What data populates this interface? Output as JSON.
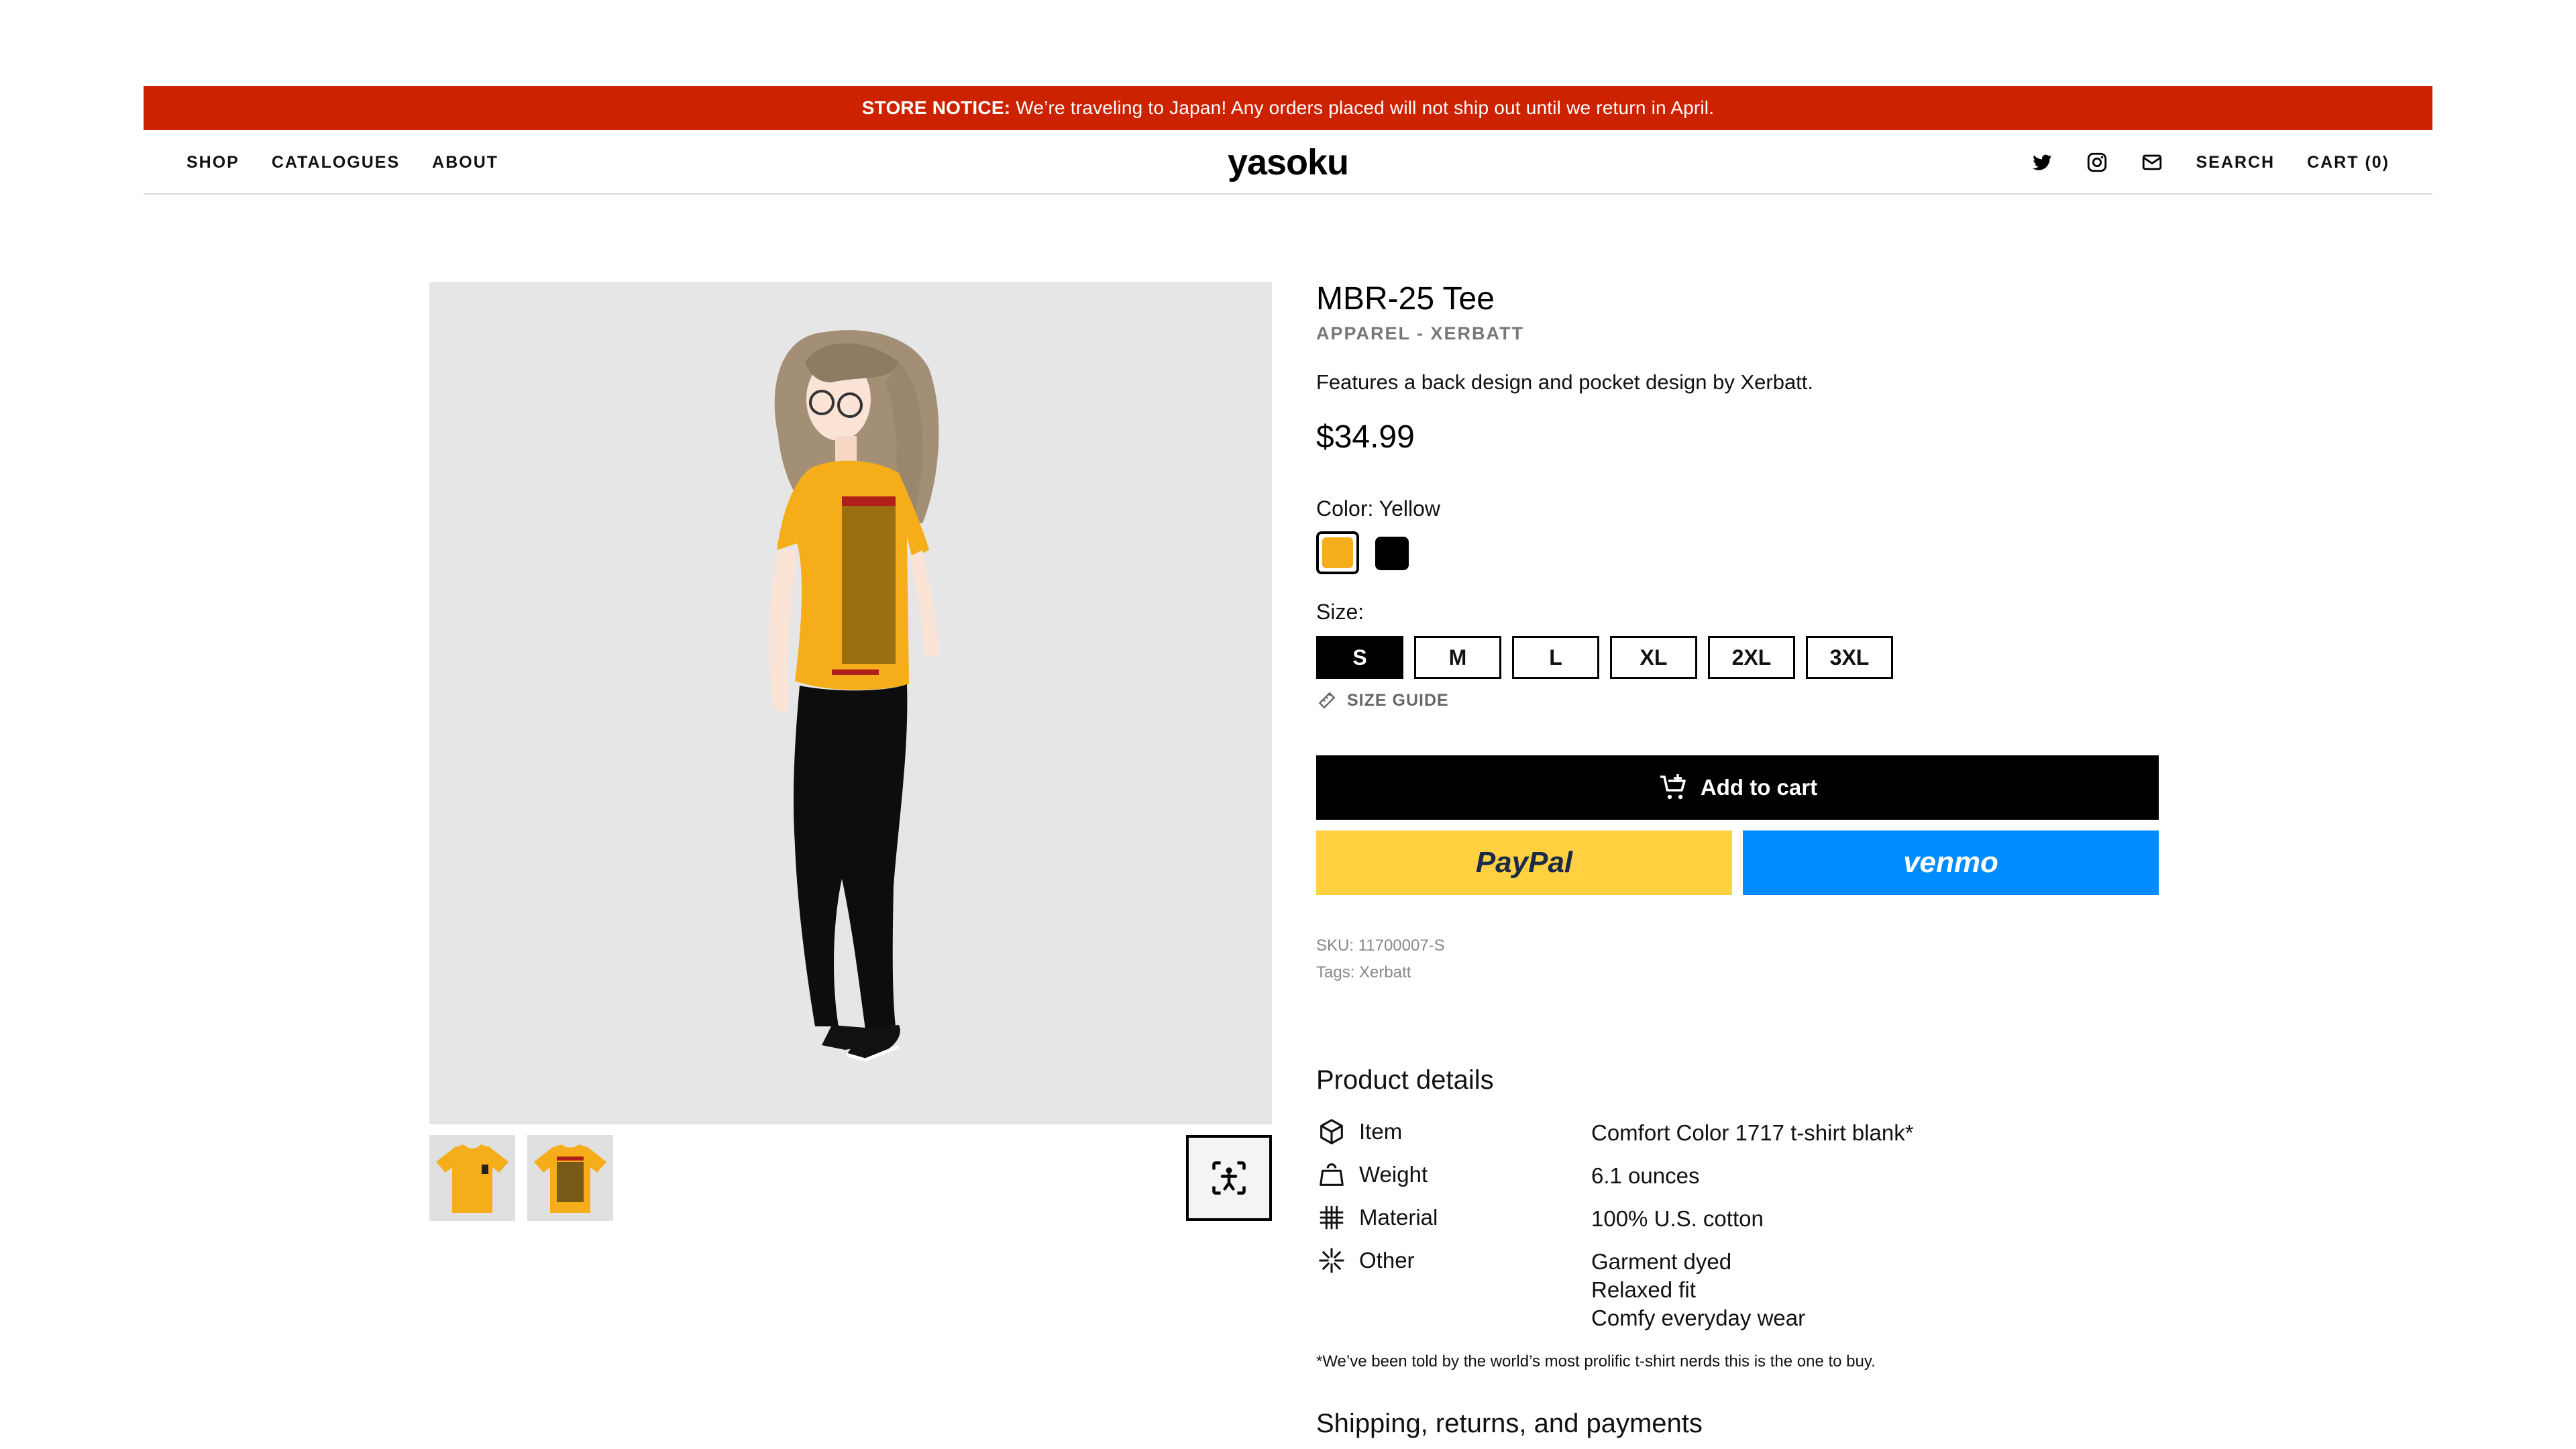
{
  "notice": {
    "label": "STORE NOTICE:",
    "text": "We’re traveling to Japan! Any orders placed will not ship out until we return in April."
  },
  "header": {
    "nav": [
      "SHOP",
      "CATALOGUES",
      "ABOUT"
    ],
    "logo": "yasoku",
    "search_label": "SEARCH",
    "cart_label": "CART (0)",
    "icons": [
      "twitter-icon",
      "instagram-icon",
      "mail-icon"
    ]
  },
  "product": {
    "title": "MBR-25 Tee",
    "category": "APPAREL - XERBATT",
    "description": "Features a back design and pocket design by Xerbatt.",
    "price": "$34.99",
    "color_label": "Color: Yellow",
    "colors": [
      {
        "name": "Yellow",
        "hex": "#f5ae1a"
      },
      {
        "name": "Black",
        "hex": "#000000"
      }
    ],
    "size_label": "Size:",
    "sizes": [
      "S",
      "M",
      "L",
      "XL",
      "2XL",
      "3XL"
    ],
    "selected_size": "S",
    "size_guide": "SIZE GUIDE",
    "add_to_cart": "Add to cart",
    "paypal": "PayPal",
    "venmo": "venmo",
    "sku": "SKU: 11700007-S",
    "tags": "Tags: Xerbatt"
  },
  "details": {
    "title": "Product details",
    "rows": [
      {
        "icon": "box-icon",
        "label": "Item",
        "value": [
          "Comfort Color 1717 t-shirt blank*"
        ]
      },
      {
        "icon": "weight-icon",
        "label": "Weight",
        "value": [
          "6.1 ounces"
        ]
      },
      {
        "icon": "grid-icon",
        "label": "Material",
        "value": [
          "100% U.S. cotton"
        ]
      },
      {
        "icon": "sparkle-icon",
        "label": "Other",
        "value": [
          "Garment dyed",
          "Relaxed fit",
          "Comfy everyday wear"
        ]
      }
    ],
    "footnote": "*We’ve been told by the world’s most prolific t-shirt nerds this is the one to buy."
  },
  "shipping_title": "Shipping, returns, and payments",
  "colors": {
    "notice_bg": "#cc2200",
    "paypal_bg": "#ffd140",
    "venmo_bg": "#008cff",
    "shirt": "#f5ae1a"
  }
}
